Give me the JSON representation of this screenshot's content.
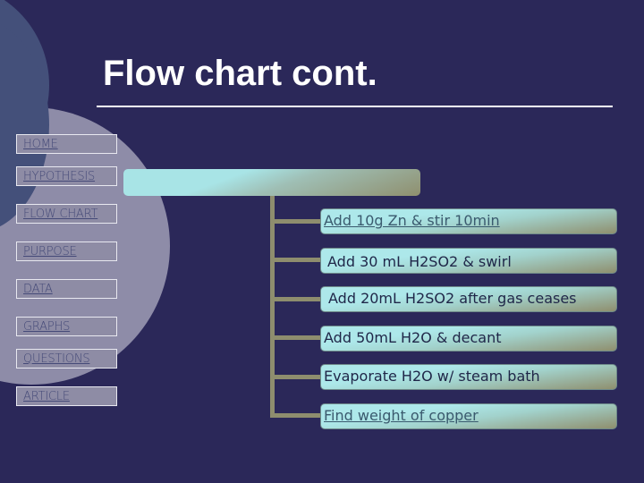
{
  "slide": {
    "title": "Flow chart cont."
  },
  "nav": {
    "items": [
      {
        "label": "HOME"
      },
      {
        "label": "HYPOTHESIS"
      },
      {
        "label": "FLOW CHART"
      },
      {
        "label": "PURPOSE"
      },
      {
        "label": "DATA"
      },
      {
        "label": "GRAPHS"
      },
      {
        "label": "QUESTIONS"
      },
      {
        "label": "ARTICLE"
      }
    ]
  },
  "flowchart": {
    "header": "",
    "steps": [
      {
        "label": "Add 10g Zn & stir 10min",
        "is_link": true
      },
      {
        "label": "Add 30 mL H2SO2 & swirl",
        "is_link": false
      },
      {
        "label": "Add 20mL H2SO2 after gas ceases",
        "is_link": false
      },
      {
        "label": "Add 50mL H2O & decant",
        "is_link": false
      },
      {
        "label": "Evaporate H2O w/ steam bath",
        "is_link": false
      },
      {
        "label": "Find weight of copper",
        "is_link": true
      }
    ]
  },
  "colors": {
    "background": "#2b2859",
    "connector": "#8e8d6e",
    "box_light": "#ade8ea",
    "nav_button": "#8e8ca5"
  }
}
